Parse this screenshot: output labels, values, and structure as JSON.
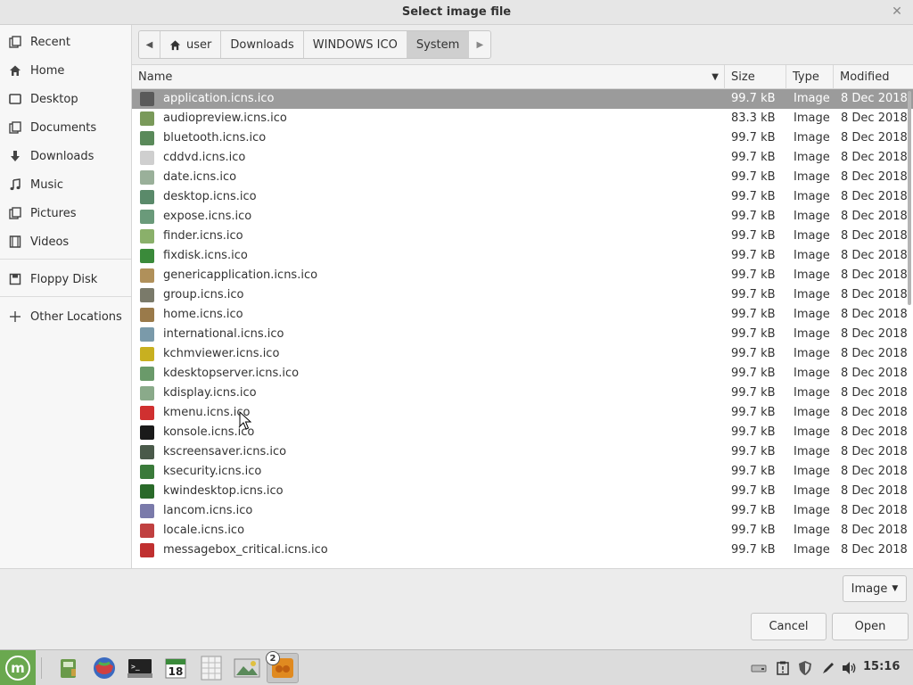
{
  "dialog": {
    "title": "Select image file"
  },
  "sidebar": {
    "items": [
      {
        "label": "Recent",
        "icon": "recent-icon"
      },
      {
        "label": "Home",
        "icon": "home-icon"
      },
      {
        "label": "Desktop",
        "icon": "desktop-icon"
      },
      {
        "label": "Documents",
        "icon": "documents-icon"
      },
      {
        "label": "Downloads",
        "icon": "downloads-icon"
      },
      {
        "label": "Music",
        "icon": "music-icon"
      },
      {
        "label": "Pictures",
        "icon": "pictures-icon"
      },
      {
        "label": "Videos",
        "icon": "videos-icon"
      },
      {
        "label": "Floppy Disk",
        "icon": "floppy-disk-icon"
      },
      {
        "label": "Other Locations",
        "icon": "plus-icon"
      }
    ]
  },
  "breadcrumb": {
    "items": [
      "user",
      "Downloads",
      "WINDOWS ICO",
      "System"
    ],
    "active": "System"
  },
  "table": {
    "columns": [
      "Name",
      "Size",
      "Type",
      "Modified"
    ],
    "selected_index": 0,
    "rows": [
      {
        "name": "application.icns.ico",
        "size": "99.7 kB",
        "type": "Image",
        "modified": "8 Dec 2018",
        "icon_color": "#5a5a5a"
      },
      {
        "name": "audiopreview.icns.ico",
        "size": "83.3 kB",
        "type": "Image",
        "modified": "8 Dec 2018",
        "icon_color": "#7a9a5a"
      },
      {
        "name": "bluetooth.icns.ico",
        "size": "99.7 kB",
        "type": "Image",
        "modified": "8 Dec 2018",
        "icon_color": "#5a8a5a"
      },
      {
        "name": "cddvd.icns.ico",
        "size": "99.7 kB",
        "type": "Image",
        "modified": "8 Dec 2018",
        "icon_color": "#cfcfcf"
      },
      {
        "name": "date.icns.ico",
        "size": "99.7 kB",
        "type": "Image",
        "modified": "8 Dec 2018",
        "icon_color": "#9ab09a"
      },
      {
        "name": "desktop.icns.ico",
        "size": "99.7 kB",
        "type": "Image",
        "modified": "8 Dec 2018",
        "icon_color": "#5a8a6a"
      },
      {
        "name": "expose.icns.ico",
        "size": "99.7 kB",
        "type": "Image",
        "modified": "8 Dec 2018",
        "icon_color": "#6a9a7a"
      },
      {
        "name": "finder.icns.ico",
        "size": "99.7 kB",
        "type": "Image",
        "modified": "8 Dec 2018",
        "icon_color": "#8ab06a"
      },
      {
        "name": "fixdisk.icns.ico",
        "size": "99.7 kB",
        "type": "Image",
        "modified": "8 Dec 2018",
        "icon_color": "#3a8a3a"
      },
      {
        "name": "genericapplication.icns.ico",
        "size": "99.7 kB",
        "type": "Image",
        "modified": "8 Dec 2018",
        "icon_color": "#b0905a"
      },
      {
        "name": "group.icns.ico",
        "size": "99.7 kB",
        "type": "Image",
        "modified": "8 Dec 2018",
        "icon_color": "#7a7a6a"
      },
      {
        "name": "home.icns.ico",
        "size": "99.7 kB",
        "type": "Image",
        "modified": "8 Dec 2018",
        "icon_color": "#9a7a4a"
      },
      {
        "name": "international.icns.ico",
        "size": "99.7 kB",
        "type": "Image",
        "modified": "8 Dec 2018",
        "icon_color": "#7a9aaa"
      },
      {
        "name": "kchmviewer.icns.ico",
        "size": "99.7 kB",
        "type": "Image",
        "modified": "8 Dec 2018",
        "icon_color": "#c8b020"
      },
      {
        "name": "kdesktopserver.icns.ico",
        "size": "99.7 kB",
        "type": "Image",
        "modified": "8 Dec 2018",
        "icon_color": "#6a9a6a"
      },
      {
        "name": "kdisplay.icns.ico",
        "size": "99.7 kB",
        "type": "Image",
        "modified": "8 Dec 2018",
        "icon_color": "#8aaa8a"
      },
      {
        "name": "kmenu.icns.ico",
        "size": "99.7 kB",
        "type": "Image",
        "modified": "8 Dec 2018",
        "icon_color": "#d03030"
      },
      {
        "name": "konsole.icns.ico",
        "size": "99.7 kB",
        "type": "Image",
        "modified": "8 Dec 2018",
        "icon_color": "#1a1a1a"
      },
      {
        "name": "kscreensaver.icns.ico",
        "size": "99.7 kB",
        "type": "Image",
        "modified": "8 Dec 2018",
        "icon_color": "#4a5a4a"
      },
      {
        "name": "ksecurity.icns.ico",
        "size": "99.7 kB",
        "type": "Image",
        "modified": "8 Dec 2018",
        "icon_color": "#3a7a3a"
      },
      {
        "name": "kwindesktop.icns.ico",
        "size": "99.7 kB",
        "type": "Image",
        "modified": "8 Dec 2018",
        "icon_color": "#2a6a2a"
      },
      {
        "name": "lancom.icns.ico",
        "size": "99.7 kB",
        "type": "Image",
        "modified": "8 Dec 2018",
        "icon_color": "#7a7aaa"
      },
      {
        "name": "locale.icns.ico",
        "size": "99.7 kB",
        "type": "Image",
        "modified": "8 Dec 2018",
        "icon_color": "#c04040"
      },
      {
        "name": "messagebox_critical.icns.ico",
        "size": "99.7 kB",
        "type": "Image",
        "modified": "8 Dec 2018",
        "icon_color": "#c03030"
      }
    ]
  },
  "footer": {
    "filter_label": "Image",
    "cancel_label": "Cancel",
    "open_label": "Open"
  },
  "taskbar": {
    "menu_label": "m",
    "launchers": [
      {
        "name": "file-manager-launcher",
        "icon": "green-book-icon",
        "color": "#6a9a4a"
      },
      {
        "name": "browser-launcher",
        "icon": "globe-icon",
        "color": "#3a6ac0"
      },
      {
        "name": "terminal-launcher",
        "icon": "terminal-icon",
        "color": "#222222"
      },
      {
        "name": "calendar-launcher",
        "icon": "calendar-icon",
        "color": "#3a8a3a",
        "text": "18"
      },
      {
        "name": "spreadsheet-launcher",
        "icon": "spreadsheet-icon",
        "color": "#aaaaaa"
      },
      {
        "name": "image-viewer-launcher",
        "icon": "image-viewer-icon",
        "color": "#5a8a5a"
      },
      {
        "name": "dialog-task-launcher",
        "icon": "orange-app-icon",
        "color": "#e08a20"
      }
    ],
    "window_badge": "2",
    "tray": [
      "drive-icon",
      "clipboard-icon",
      "shield-icon",
      "pen-icon",
      "volume-icon"
    ],
    "clock": "15:16"
  },
  "colors": {
    "selection": "#9b9b9b",
    "mint_green": "#6aa84f"
  }
}
